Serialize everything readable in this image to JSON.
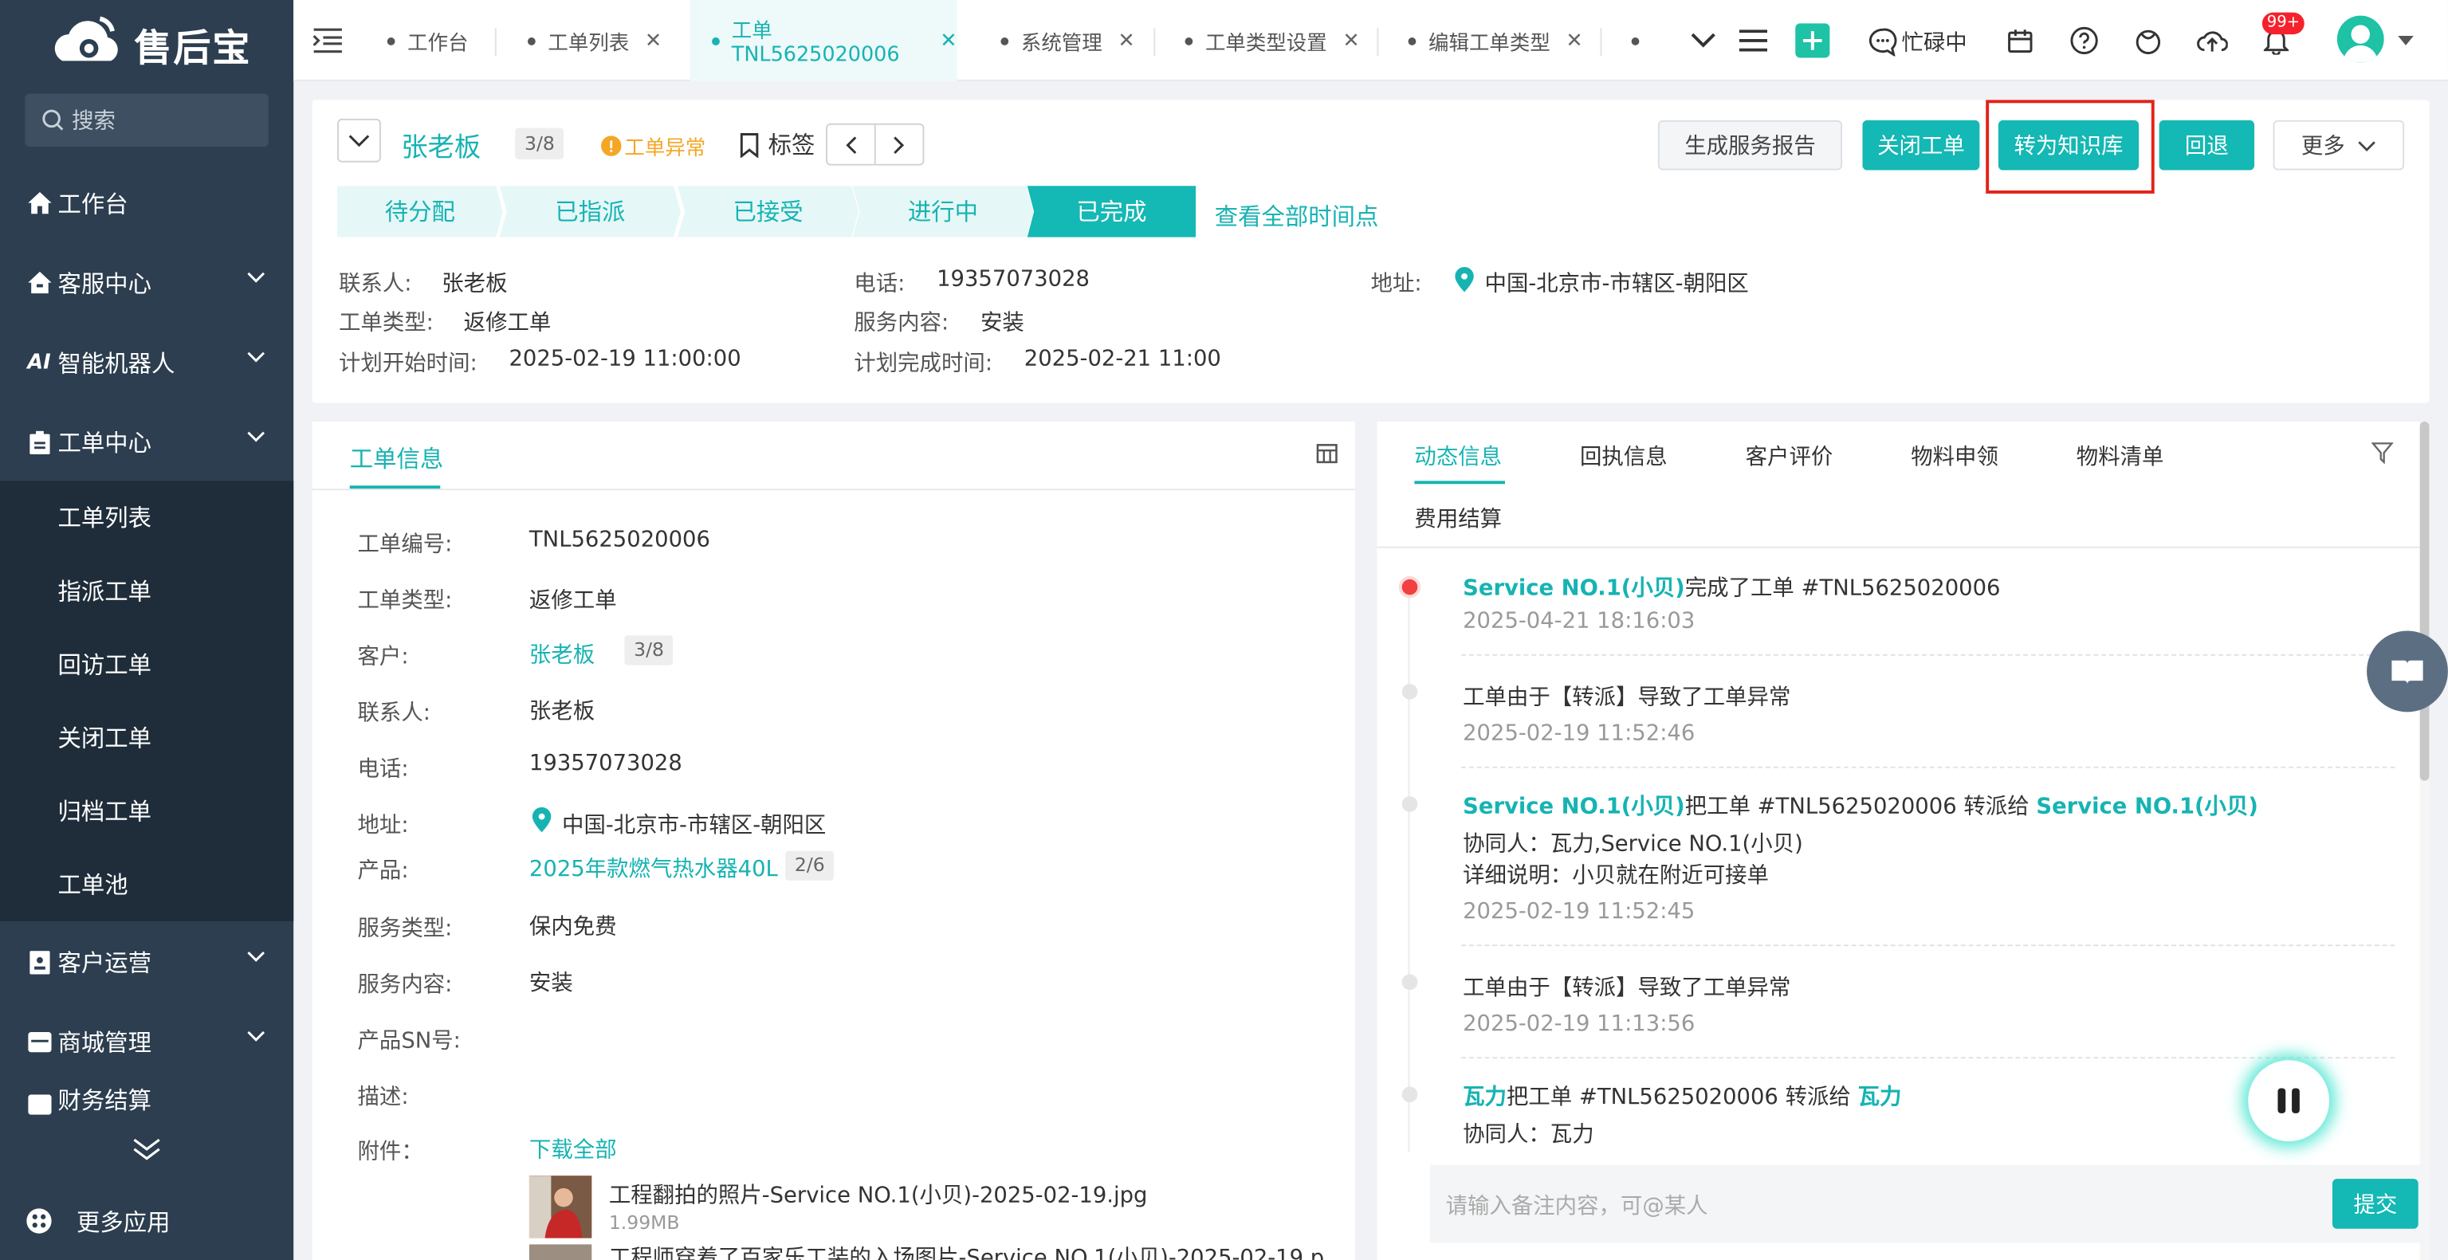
{
  "app": {
    "brand": "售后宝",
    "search_placeholder": "搜索"
  },
  "sidebar": {
    "items": [
      {
        "label": "工作台",
        "icon": "home-icon"
      },
      {
        "label": "客服中心",
        "icon": "home-icon"
      },
      {
        "label": "智能机器人",
        "icon": "ai-icon"
      },
      {
        "label": "工单中心",
        "icon": "clipboard-icon"
      },
      {
        "label": "客户运营",
        "icon": "user-card-icon"
      },
      {
        "label": "商城管理",
        "icon": "store-icon"
      },
      {
        "label": "财务结算",
        "icon": "money-icon"
      }
    ],
    "sub_items": [
      "工单列表",
      "指派工单",
      "回访工单",
      "关闭工单",
      "归档工单",
      "工单池"
    ],
    "more_apps": "更多应用"
  },
  "tabs": [
    {
      "label": "工作台",
      "closable": false
    },
    {
      "label": "工单列表",
      "closable": true
    },
    {
      "label": "工单TNL5625020006",
      "closable": true,
      "active": true
    },
    {
      "label": "系统管理",
      "closable": true
    },
    {
      "label": "工单类型设置",
      "closable": true
    },
    {
      "label": "编辑工单类型",
      "closable": true
    }
  ],
  "topbar": {
    "status": "忙碌中",
    "notification_count": "99+"
  },
  "header": {
    "customer_name": "张老板",
    "count_badge": "3/8",
    "exception": "工单异常",
    "tag_label": "标签",
    "buttons": {
      "report": "生成服务报告",
      "close": "关闭工单",
      "to_kb": "转为知识库",
      "back": "回退",
      "more": "更多"
    },
    "steps": [
      "待分配",
      "已指派",
      "已接受",
      "进行中",
      "已完成"
    ],
    "view_all": "查看全部时间点",
    "fields": {
      "contact_label": "联系人:",
      "contact": "张老板",
      "phone_label": "电话:",
      "phone": "19357073028",
      "address_label": "地址:",
      "address": "中国-北京市-市辖区-朝阳区",
      "type_label": "工单类型:",
      "type": "返修工单",
      "content_label": "服务内容:",
      "content": "安装",
      "start_label": "计划开始时间:",
      "start": "2025-02-19 11:00:00",
      "end_label": "计划完成时间:",
      "end": "2025-02-21 11:00"
    }
  },
  "info": {
    "tab": "工单信息",
    "rows": [
      {
        "label": "工单编号:",
        "value": "TNL5625020006"
      },
      {
        "label": "工单类型:",
        "value": "返修工单"
      },
      {
        "label": "客户:",
        "value": "张老板",
        "badge": "3/8",
        "link": true
      },
      {
        "label": "联系人:",
        "value": "张老板"
      },
      {
        "label": "电话:",
        "value": "19357073028"
      },
      {
        "label": "地址:",
        "value": "中国-北京市-市辖区-朝阳区"
      },
      {
        "label": "产品:",
        "value": "2025年款燃气热水器40L",
        "badge": "2/6",
        "link": true
      },
      {
        "label": "服务类型:",
        "value": "保内免费"
      },
      {
        "label": "服务内容:",
        "value": "安装"
      },
      {
        "label": "产品SN号:",
        "value": ""
      },
      {
        "label": "描述:",
        "value": ""
      },
      {
        "label": "附件：",
        "value": "下载全部",
        "link": true
      }
    ],
    "attachments": [
      {
        "name": "工程翻拍的照片-Service NO.1(小贝)-2025-02-19.jpg",
        "size": "1.99MB"
      },
      {
        "name": "工程师穿着了百家乐工装的入场图片-Service NO.1(小贝)-2025-02-19.p",
        "size": ""
      }
    ]
  },
  "activity": {
    "tabs": [
      "动态信息",
      "回执信息",
      "客户评价",
      "物料申领",
      "物料清单",
      "费用结算"
    ],
    "feed": [
      {
        "actor": "Service NO.1(小贝)",
        "text": "完成了工单 #TNL5625020006",
        "time": "2025-04-21 18:16:03"
      },
      {
        "text": "工单由于【转派】导致了工单异常",
        "time": "2025-02-19 11:52:46"
      },
      {
        "actor": "Service NO.1(小贝)",
        "text": "把工单 #TNL5625020006 转派给 ",
        "target": "Service NO.1(小贝)",
        "line2": "协同人：瓦力,Service NO.1(小贝)",
        "line3": "详细说明：小贝就在附近可接单",
        "time": "2025-02-19 11:52:45"
      },
      {
        "text": "工单由于【转派】导致了工单异常",
        "time": "2025-02-19 11:13:56"
      },
      {
        "actor": "瓦力",
        "text": "把工单 #TNL5625020006 转派给 ",
        "target": "瓦力",
        "line2": "协同人：瓦力"
      }
    ],
    "comment_placeholder": "请输入备注内容，可@某人",
    "submit": "提交"
  }
}
